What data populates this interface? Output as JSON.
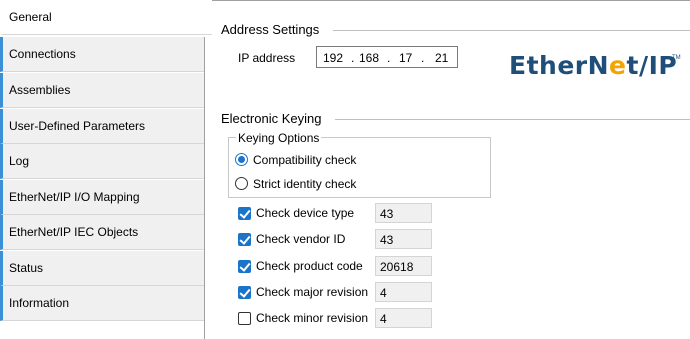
{
  "sidebar": {
    "items": [
      {
        "label": "General"
      },
      {
        "label": "Connections"
      },
      {
        "label": "Assemblies"
      },
      {
        "label": "User-Defined Parameters"
      },
      {
        "label": "Log"
      },
      {
        "label": "EtherNet/IP I/O Mapping"
      },
      {
        "label": "EtherNet/IP IEC Objects"
      },
      {
        "label": "Status"
      },
      {
        "label": "Information"
      }
    ],
    "active_index": 0,
    "accent_color": "#3a8fd6"
  },
  "address_settings": {
    "title": "Address Settings",
    "ip_label": "IP address",
    "ip_octets": [
      "192",
      "168",
      "17",
      "21"
    ]
  },
  "logo": {
    "text_before": "EtherN",
    "text_accent": "e",
    "text_after": "t/IP",
    "tm": "TM",
    "colors": {
      "main": "#1f4e79",
      "accent": "#f5a300"
    }
  },
  "electronic_keying": {
    "title": "Electronic Keying",
    "keying_options": {
      "title": "Keying Options",
      "options": [
        {
          "label": "Compatibility check",
          "selected": true
        },
        {
          "label": "Strict identity check",
          "selected": false
        }
      ]
    },
    "checks": [
      {
        "label": "Check device type",
        "checked": true,
        "value": "43"
      },
      {
        "label": "Check vendor ID",
        "checked": true,
        "value": "43"
      },
      {
        "label": "Check product code",
        "checked": true,
        "value": "20618"
      },
      {
        "label": "Check major revision",
        "checked": true,
        "value": "4"
      },
      {
        "label": "Check minor revision",
        "checked": false,
        "value": "4"
      }
    ]
  }
}
